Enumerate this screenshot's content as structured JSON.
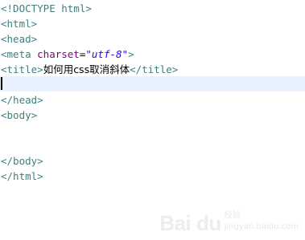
{
  "editor": {
    "lines": [
      {
        "text": "<!DOCTYPE html>"
      },
      {
        "text": "<html>"
      },
      {
        "text": "<head>"
      },
      {
        "meta_open": "<meta ",
        "meta_attr": "charset",
        "meta_eq": "=",
        "meta_val": "\"utf-8\"",
        "meta_close": ">"
      },
      {
        "title_open": "<title>",
        "title_text": "如何用css取消斜体",
        "title_close": "</title>"
      },
      {
        "text": ""
      },
      {
        "text": "</head>"
      },
      {
        "text": "<body>"
      },
      {
        "text": ""
      },
      {
        "text": ""
      },
      {
        "text": "</body>"
      },
      {
        "text": "</html>"
      }
    ],
    "current_line_index": 5
  },
  "watermark": {
    "logo_text": "Bai du",
    "sub_text": "经验",
    "url": "jingyan.baidu.com"
  },
  "colors": {
    "tag": "#3f7f7f",
    "attribute": "#7f007f",
    "string": "#2a00ff",
    "current_line": "#e8f2fe"
  }
}
